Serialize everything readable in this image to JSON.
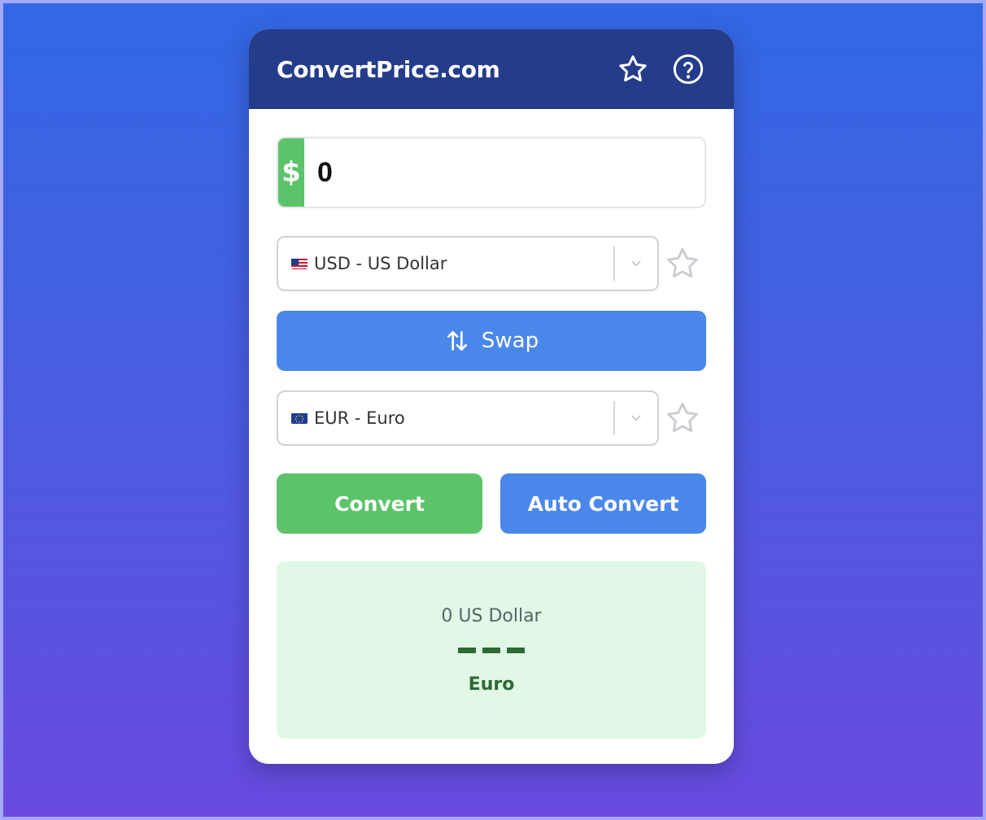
{
  "header": {
    "brand": "ConvertPrice.com"
  },
  "amount": {
    "symbol": "$",
    "value": "0"
  },
  "from_currency": {
    "label": "USD - US Dollar",
    "flag": "us-flag"
  },
  "swap": {
    "label": "Swap"
  },
  "to_currency": {
    "label": "EUR - Euro",
    "flag": "eu-flag"
  },
  "actions": {
    "convert_label": "Convert",
    "auto_convert_label": "Auto Convert"
  },
  "result": {
    "from_text": "0 US Dollar",
    "to_text": "Euro"
  },
  "colors": {
    "header": "#243c8a",
    "green": "#5dc36a",
    "blue": "#4a87ea",
    "result_bg": "#e1f8e6",
    "result_text": "#2d6a32"
  }
}
